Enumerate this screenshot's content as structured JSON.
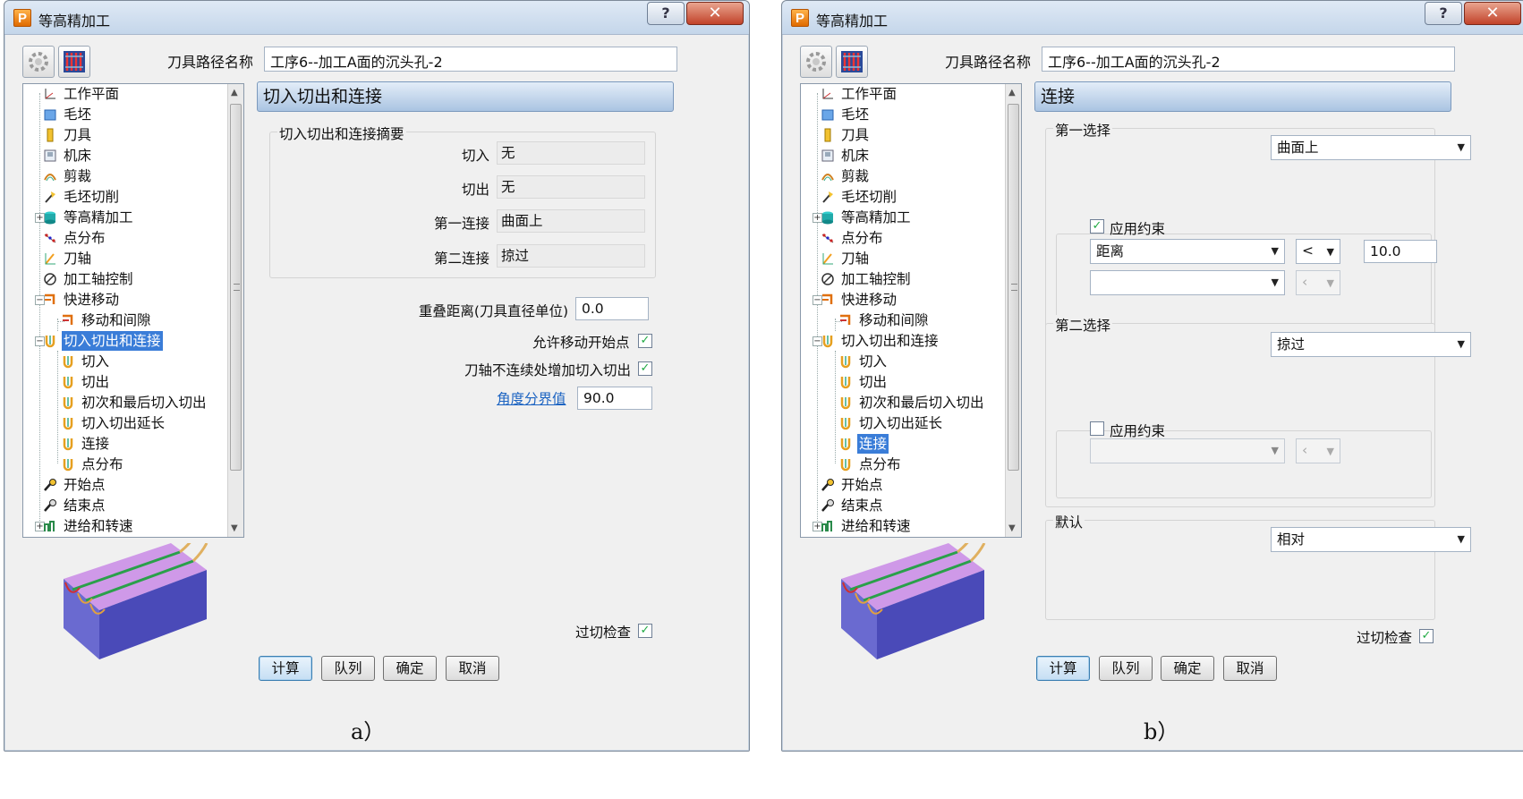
{
  "captions": {
    "a": "a）",
    "b": "b）"
  },
  "common": {
    "title": "等高精加工",
    "help_glyph": "?",
    "close_glyph": "✕",
    "toolpath_name_label": "刀具路径名称",
    "toolpath_name_value": "工序6--加工A面的沉头孔-2",
    "tree": {
      "workplane": "工作平面",
      "block": "毛坯",
      "tool": "刀具",
      "machine": "机床",
      "trim": "剪裁",
      "stock_cut": "毛坯切削",
      "constant_z": "等高精加工",
      "point_dist": "点分布",
      "tool_axis": "刀轴",
      "axis_control": "加工轴控制",
      "rapid_moves": "快进移动",
      "moves_gaps": "移动和间隙",
      "leads_links": "切入切出和连接",
      "lead_in": "切入",
      "lead_out": "切出",
      "first_last": "初次和最后切入切出",
      "extensions": "切入切出延长",
      "links": "连接",
      "point_dist2": "点分布",
      "start_point": "开始点",
      "end_point": "结束点",
      "feeds_speeds": "进给和转速"
    },
    "gouge_check_label": "过切检查",
    "buttons": {
      "calculate": "计算",
      "queue": "队列",
      "ok": "确定",
      "cancel": "取消"
    }
  },
  "dialog_a": {
    "panel_title": "切入切出和连接",
    "summary_group": "切入切出和连接摘要",
    "summary": {
      "lead_in_label": "切入",
      "lead_in_value": "无",
      "lead_out_label": "切出",
      "lead_out_value": "无",
      "first_link_label": "第一连接",
      "first_link_value": "曲面上",
      "second_link_label": "第二连接",
      "second_link_value": "掠过"
    },
    "overlap_label": "重叠距离(刀具直径单位)",
    "overlap_value": "0.0",
    "allow_move_start_label": "允许移动开始点",
    "axis_discontinuity_label": "刀轴不连续处增加切入切出",
    "angle_threshold_label": "角度分界值",
    "angle_threshold_value": "90.0"
  },
  "dialog_b": {
    "panel_title": "连接",
    "first_choice_group": "第一选择",
    "first_choice_value": "曲面上",
    "apply_constraint_label": "应用约束",
    "constraint_type": "距离",
    "constraint_op": "<",
    "constraint_value": "10.0",
    "second_choice_group": "第二选择",
    "second_choice_value": "掠过",
    "apply_constraint2_label": "应用约束",
    "default_group": "默认",
    "default_value": "相对"
  }
}
